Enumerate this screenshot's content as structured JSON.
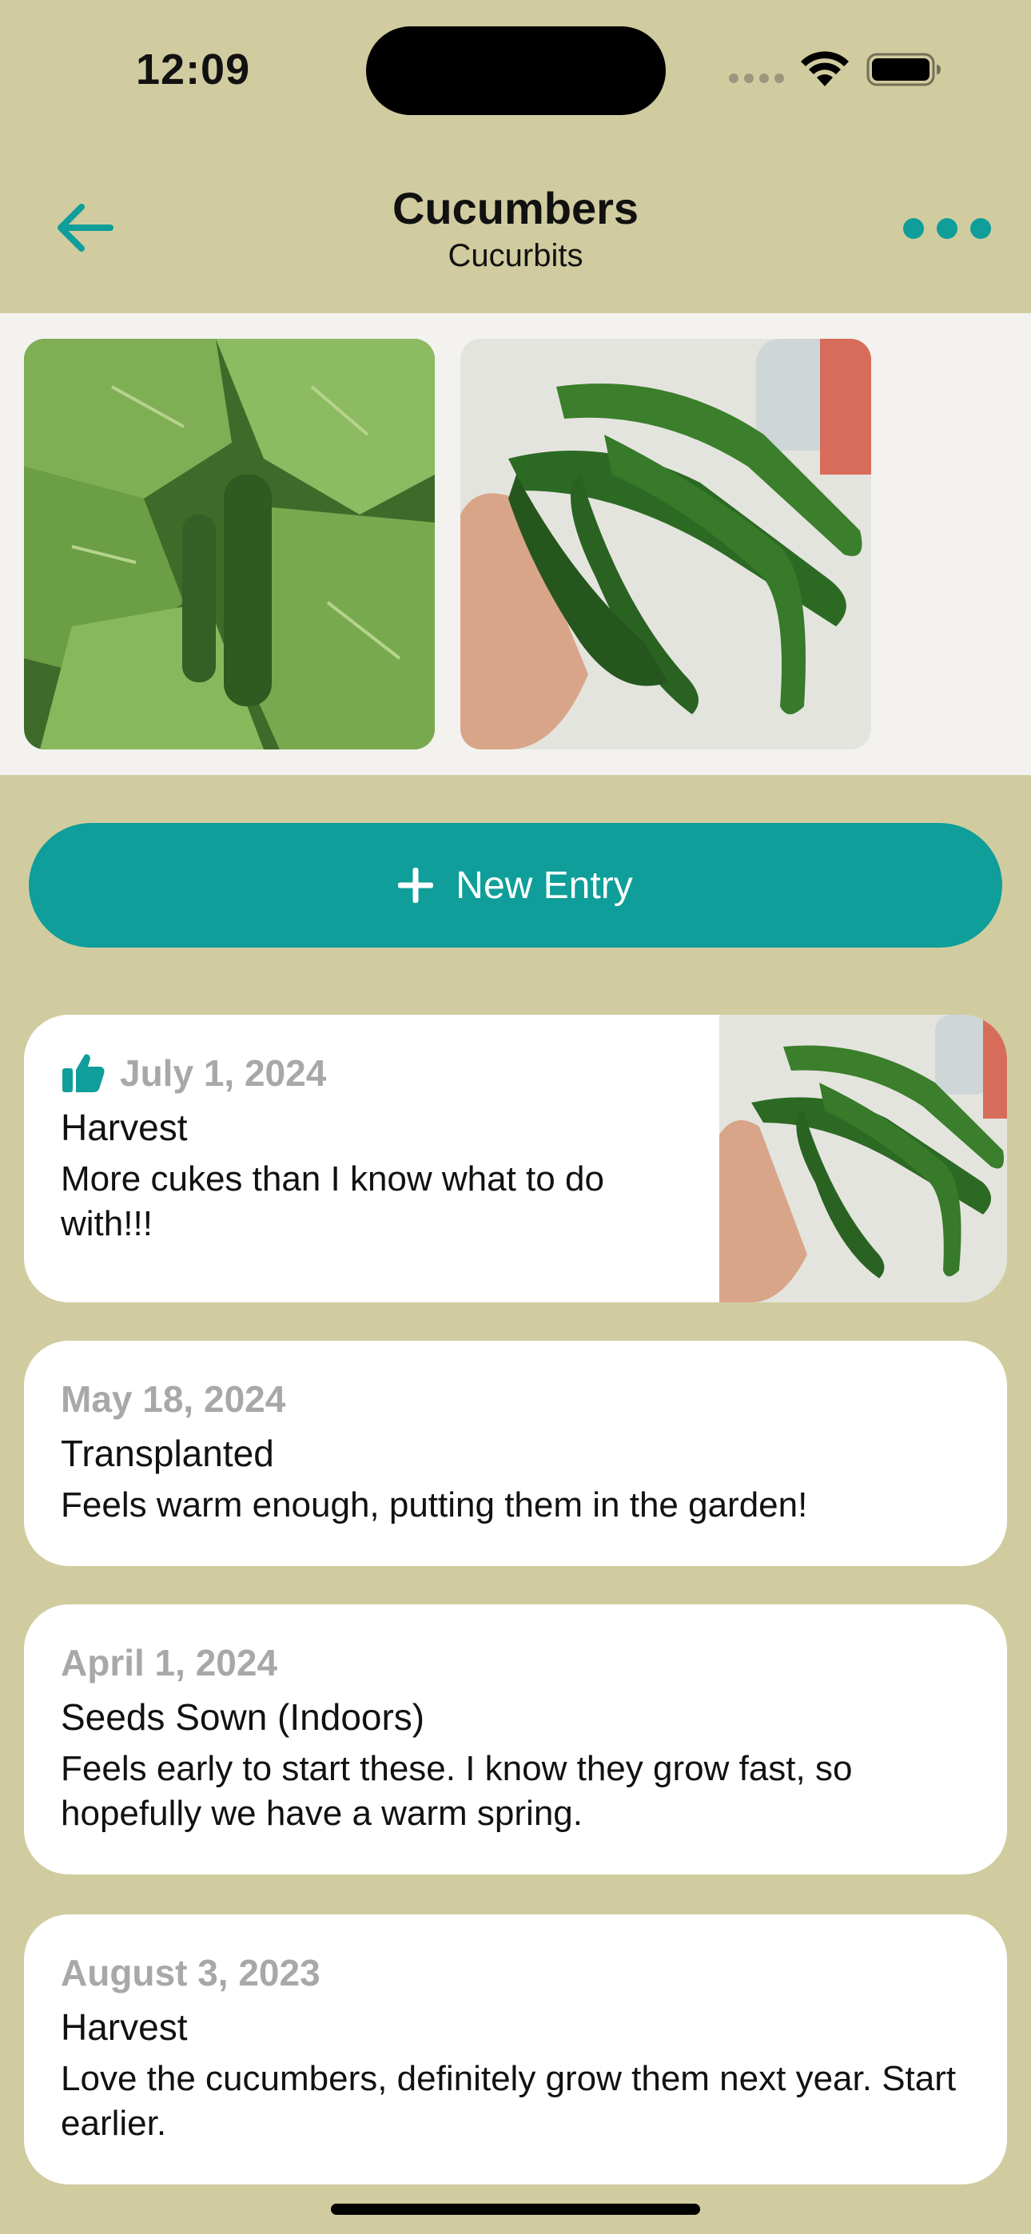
{
  "status_bar": {
    "time": "12:09"
  },
  "nav": {
    "title": "Cucumbers",
    "subtitle": "Cucurbits",
    "back_icon": "arrow-left-icon",
    "more_icon": "ellipsis-icon"
  },
  "colors": {
    "background": "#d1cca0",
    "accent": "#0f9e99",
    "card": "#ffffff",
    "date_gray": "#a8a8a8",
    "photo_strip": "#f3f2ee"
  },
  "photos": [
    {
      "subject": "cucumber-plant-leaves"
    },
    {
      "subject": "harvested-cucumbers-in-hand"
    }
  ],
  "new_entry": {
    "label": "New Entry",
    "icon": "plus-icon"
  },
  "entries": [
    {
      "date": "July 1, 2024",
      "type": "Harvest",
      "note": "More cukes than I know what to do with!!!",
      "liked": true,
      "icon": "thumbs-up-icon",
      "has_photo": true
    },
    {
      "date": "May 18, 2024",
      "type": "Transplanted",
      "note": "Feels warm enough, putting them in the garden!",
      "liked": false,
      "has_photo": false
    },
    {
      "date": "April 1, 2024",
      "type": "Seeds Sown (Indoors)",
      "note": "Feels early to start these. I know they grow fast, so hopefully we have a warm spring.",
      "liked": false,
      "has_photo": false
    },
    {
      "date": "August 3, 2023",
      "type": "Harvest",
      "note": "Love the cucumbers, definitely grow them next year. Start earlier.",
      "liked": false,
      "has_photo": false
    }
  ]
}
